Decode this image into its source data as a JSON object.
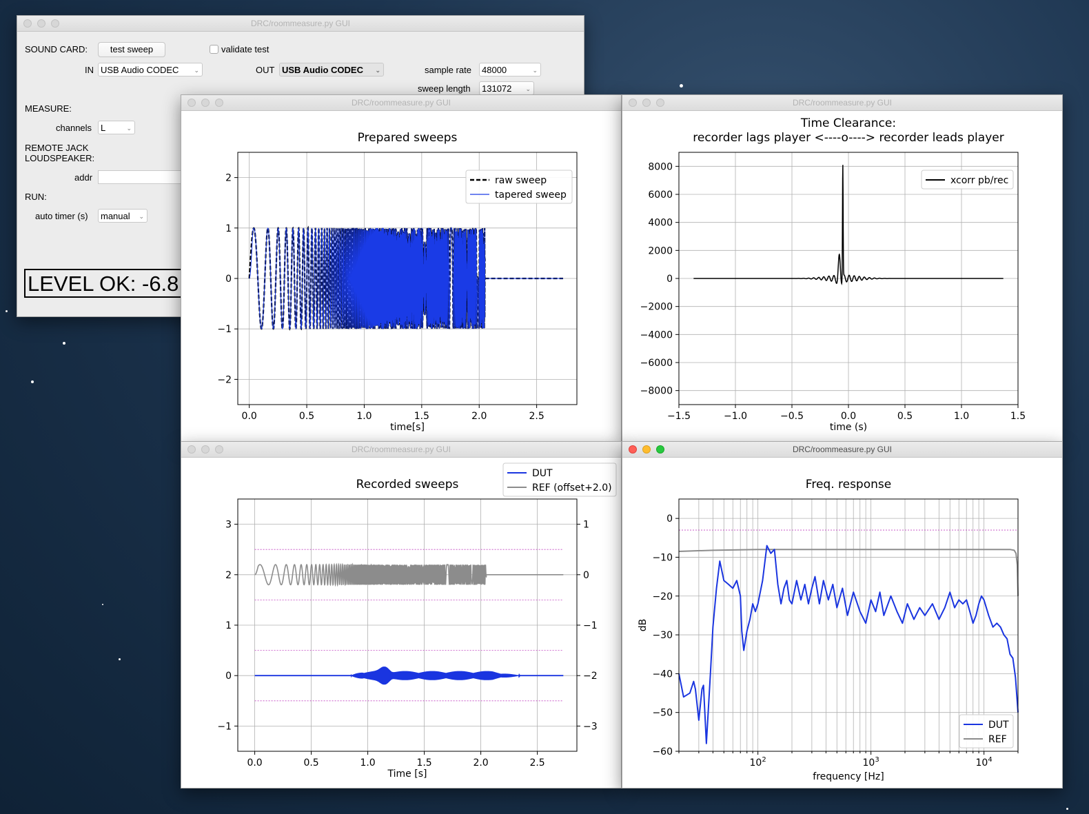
{
  "colors": {
    "dut": "#1a35e0",
    "ref": "#8c8c8c",
    "raw": "#000000",
    "tapered": "#1a3be6",
    "xcorr": "#000000",
    "guide": "#c040c0"
  },
  "main_window": {
    "title": "DRC/roommeasure.py GUI",
    "sound_card_label": "SOUND CARD:",
    "test_sweep_button": "test sweep",
    "validate_test_label": "validate test",
    "in_label": "IN",
    "in_value": "USB Audio CODEC",
    "out_label": "OUT",
    "out_value": "USB Audio CODEC",
    "sample_rate_label": "sample rate",
    "sample_rate_value": "48000",
    "sweep_length_label": "sweep length",
    "sweep_length_value": "131072",
    "measure_label": "MEASURE:",
    "channels_label": "channels",
    "channels_value": "L",
    "remote_label_1": "REMOTE JACK",
    "remote_label_2": "LOUDSPEAKER:",
    "addr_label": "addr",
    "addr_value": "",
    "run_label": "RUN:",
    "auto_timer_label": "auto timer (s)",
    "auto_timer_value": "manual",
    "level_text": "LEVEL OK: -6.8"
  },
  "plot_windows": [
    {
      "title": "DRC/roommeasure.py GUI"
    },
    {
      "title": "DRC/roommeasure.py GUI"
    },
    {
      "title": "DRC/roommeasure.py GUI"
    },
    {
      "title": "DRC/roommeasure.py GUI"
    }
  ],
  "chart_data": [
    {
      "type": "line",
      "title": "Prepared sweeps",
      "xlabel": "time[s]",
      "ylabel": "",
      "xlim": [
        -0.1,
        2.85
      ],
      "ylim": [
        -2.5,
        2.5
      ],
      "xticks": [
        "0.0",
        "0.5",
        "1.0",
        "1.5",
        "2.0",
        "2.5"
      ],
      "yticks": [
        "−2",
        "−1",
        "0",
        "1",
        "2"
      ],
      "grid": true,
      "legend": "top-right",
      "series": [
        {
          "name": "raw sweep",
          "style": "dashed",
          "description": "log sweep ±1 from 0 to 2.05 s, then 0 until 2.73 s"
        },
        {
          "name": "tapered sweep",
          "style": "solid",
          "description": "tapered log sweep ±1 from 0 to 2.05 s, then 0 until 2.73 s"
        }
      ]
    },
    {
      "type": "line",
      "title_line1": "Time Clearance:",
      "title_line2": "recorder lags  player <----o----> recorder leads player",
      "xlabel": "time (s)",
      "ylabel": "",
      "xlim": [
        -1.5,
        1.5
      ],
      "ylim": [
        -9000,
        9000
      ],
      "xticks": [
        "−1.5",
        "−1.0",
        "−0.5",
        "0.0",
        "0.5",
        "1.0",
        "1.5"
      ],
      "yticks": [
        "−8000",
        "−6000",
        "−4000",
        "−2000",
        "0",
        "2000",
        "4000",
        "6000",
        "8000"
      ],
      "grid": true,
      "legend": "top-right",
      "series": [
        {
          "name": "xcorr pb/rec",
          "peak_x": -0.05,
          "peak_y": 8200,
          "min_y": -1000,
          "x_range": [
            -1.37,
            1.37
          ]
        }
      ]
    },
    {
      "type": "line",
      "title": "Recorded sweeps",
      "xlabel": "Time [s]",
      "ylabel": "",
      "xlim": [
        -0.15,
        2.85
      ],
      "ylim": [
        -1.5,
        3.5
      ],
      "xticks": [
        "0.0",
        "0.5",
        "1.0",
        "1.5",
        "2.0",
        "2.5"
      ],
      "yticks": [
        "−1",
        "0",
        "1",
        "2",
        "3"
      ],
      "y2ticks": [
        "−3",
        "−2",
        "−1",
        "0",
        "1"
      ],
      "grid": true,
      "legend": "above-right",
      "guide_lines": [
        2.5,
        1.5,
        0.5,
        -0.5
      ],
      "series": [
        {
          "name": "DUT",
          "baseline": 0,
          "burst_range": [
            0.85,
            2.35
          ],
          "peak_amplitude": 0.2
        },
        {
          "name": "REF (offset+2.0)",
          "baseline": 2,
          "sweep_range": [
            0.0,
            2.05
          ],
          "amplitude": 0.2,
          "end_x": 2.73
        }
      ]
    },
    {
      "type": "line",
      "title": "Freq. response",
      "xlabel": "frequency [Hz]",
      "ylabel": "dB",
      "xscale": "log",
      "xlim": [
        20,
        20000
      ],
      "ylim": [
        -60,
        5
      ],
      "xticks": [
        "10^2",
        "10^3",
        "10^4"
      ],
      "yticks": [
        "−60",
        "−50",
        "−40",
        "−30",
        "−20",
        "−10",
        "0"
      ],
      "grid": true,
      "legend": "bottom-right",
      "guide_line_db": -3,
      "series": [
        {
          "name": "DUT",
          "points": [
            [
              20,
              -40
            ],
            [
              22,
              -46
            ],
            [
              25,
              -45
            ],
            [
              27,
              -42
            ],
            [
              28,
              -44
            ],
            [
              30,
              -52
            ],
            [
              32,
              -44
            ],
            [
              33,
              -43
            ],
            [
              35,
              -58
            ],
            [
              38,
              -40
            ],
            [
              40,
              -28
            ],
            [
              43,
              -18
            ],
            [
              46,
              -11
            ],
            [
              50,
              -16
            ],
            [
              55,
              -17
            ],
            [
              60,
              -18
            ],
            [
              65,
              -16
            ],
            [
              70,
              -20
            ],
            [
              72,
              -29
            ],
            [
              75,
              -34
            ],
            [
              80,
              -29
            ],
            [
              85,
              -26
            ],
            [
              90,
              -22
            ],
            [
              95,
              -24
            ],
            [
              100,
              -22
            ],
            [
              110,
              -16
            ],
            [
              120,
              -7
            ],
            [
              130,
              -9
            ],
            [
              140,
              -8
            ],
            [
              150,
              -17
            ],
            [
              160,
              -22
            ],
            [
              170,
              -18
            ],
            [
              180,
              -16
            ],
            [
              190,
              -21
            ],
            [
              200,
              -22
            ],
            [
              220,
              -16
            ],
            [
              240,
              -21
            ],
            [
              260,
              -17
            ],
            [
              280,
              -22
            ],
            [
              300,
              -18
            ],
            [
              320,
              -15
            ],
            [
              350,
              -22
            ],
            [
              380,
              -16
            ],
            [
              420,
              -21
            ],
            [
              460,
              -17
            ],
            [
              500,
              -23
            ],
            [
              560,
              -18
            ],
            [
              620,
              -25
            ],
            [
              700,
              -19
            ],
            [
              800,
              -24
            ],
            [
              900,
              -27
            ],
            [
              1000,
              -21
            ],
            [
              1100,
              -24
            ],
            [
              1200,
              -19
            ],
            [
              1300,
              -25
            ],
            [
              1500,
              -20
            ],
            [
              1700,
              -24
            ],
            [
              1900,
              -27
            ],
            [
              2100,
              -22
            ],
            [
              2400,
              -26
            ],
            [
              2700,
              -23
            ],
            [
              3000,
              -25
            ],
            [
              3500,
              -22
            ],
            [
              4000,
              -26
            ],
            [
              4500,
              -23
            ],
            [
              5000,
              -19
            ],
            [
              5500,
              -23
            ],
            [
              6000,
              -21
            ],
            [
              6500,
              -22
            ],
            [
              7000,
              -21
            ],
            [
              7500,
              -24
            ],
            [
              8000,
              -27
            ],
            [
              8500,
              -25
            ],
            [
              9000,
              -22
            ],
            [
              9500,
              -20
            ],
            [
              10000,
              -21
            ],
            [
              11000,
              -25
            ],
            [
              12000,
              -28
            ],
            [
              13000,
              -27
            ],
            [
              14000,
              -28
            ],
            [
              15000,
              -30
            ],
            [
              16000,
              -31
            ],
            [
              17000,
              -35
            ],
            [
              18000,
              -36
            ],
            [
              19000,
              -41
            ],
            [
              20000,
              -50
            ]
          ]
        },
        {
          "name": "REF",
          "points": [
            [
              20,
              -8.5
            ],
            [
              40,
              -8.2
            ],
            [
              100,
              -8
            ],
            [
              1000,
              -8
            ],
            [
              10000,
              -8
            ],
            [
              17000,
              -8
            ],
            [
              18500,
              -8.2
            ],
            [
              19200,
              -9
            ],
            [
              19700,
              -12
            ],
            [
              20000,
              -20
            ]
          ]
        }
      ]
    }
  ]
}
